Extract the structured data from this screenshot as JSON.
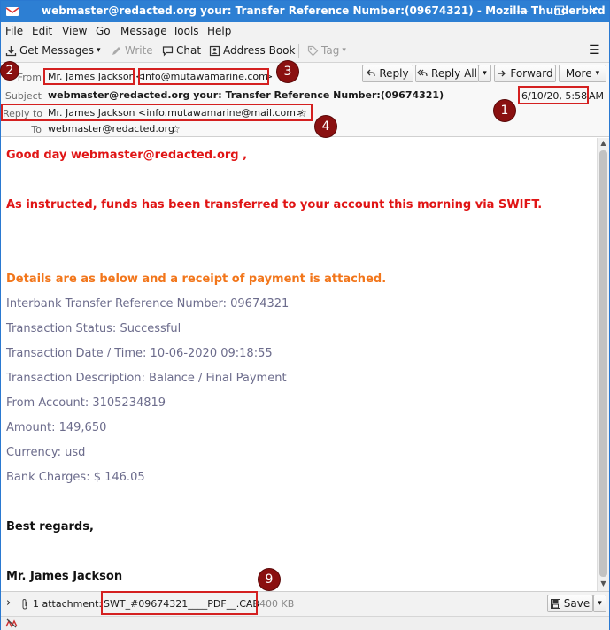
{
  "window": {
    "title": "webmaster@redacted.org your: Transfer Reference Number:(09674321) - Mozilla Thunderbird",
    "minimize": "—",
    "maximize": "☐",
    "close": "✕"
  },
  "menu": [
    "File",
    "Edit",
    "View",
    "Go",
    "Message",
    "Tools",
    "Help"
  ],
  "toolbar": {
    "get_messages": "Get Messages",
    "write": "Write",
    "chat": "Chat",
    "address_book": "Address Book",
    "tag": "Tag",
    "dropdown_arrow": "▾",
    "menu_glyph": "☰"
  },
  "header": {
    "from_label": "From",
    "from_name": "Mr. James Jackson",
    "from_open": "<",
    "from_email": "info@mutawamarine.com",
    "from_close": ">",
    "subject_label": "Subject",
    "subject": "webmaster@redacted.org your: Transfer Reference Number:(09674321)",
    "date": "6/10/20, 5:58",
    "date_suffix": "AM",
    "reply_to_label": "Reply to",
    "reply_to": "Mr. James Jackson <info.mutawamarine@mail.com>",
    "to_label": "To",
    "to": "webmaster@redacted.org",
    "star": "☆",
    "buttons": {
      "reply": "Reply",
      "reply_all": "Reply All",
      "forward": "Forward",
      "more": "More",
      "arrow": "▾"
    }
  },
  "markers": {
    "m1": "1",
    "m2": "2",
    "m3": "3",
    "m4": "4",
    "m9": "9"
  },
  "body": {
    "greeting": "Good day webmaster@redacted.org ,",
    "instructed": "As instructed, funds has been transferred to your account this morning via SWIFT.",
    "details": "Details are as below and a receipt of payment is attached.",
    "ref": "Interbank Transfer Reference Number: 09674321",
    "status": "Transaction Status: Successful",
    "datetime": "Transaction Date / Time: 10-06-2020 09:18:55",
    "description": "Transaction Description: Balance / Final Payment",
    "from_account": "From Account: 3105234819",
    "amount": "Amount: 149,650",
    "currency": "Currency: usd",
    "charges": "Bank Charges: $ 146.05",
    "regards": "Best regards,",
    "signature": "Mr. James Jackson"
  },
  "attachment": {
    "toggle": "›",
    "count": "1 attachment:",
    "filename": "SWT_#09674321____PDF__.CAB",
    "size": "400 KB",
    "save": "Save",
    "arrow": "▾"
  },
  "scroll": {
    "up": "▲",
    "down": "▼"
  }
}
